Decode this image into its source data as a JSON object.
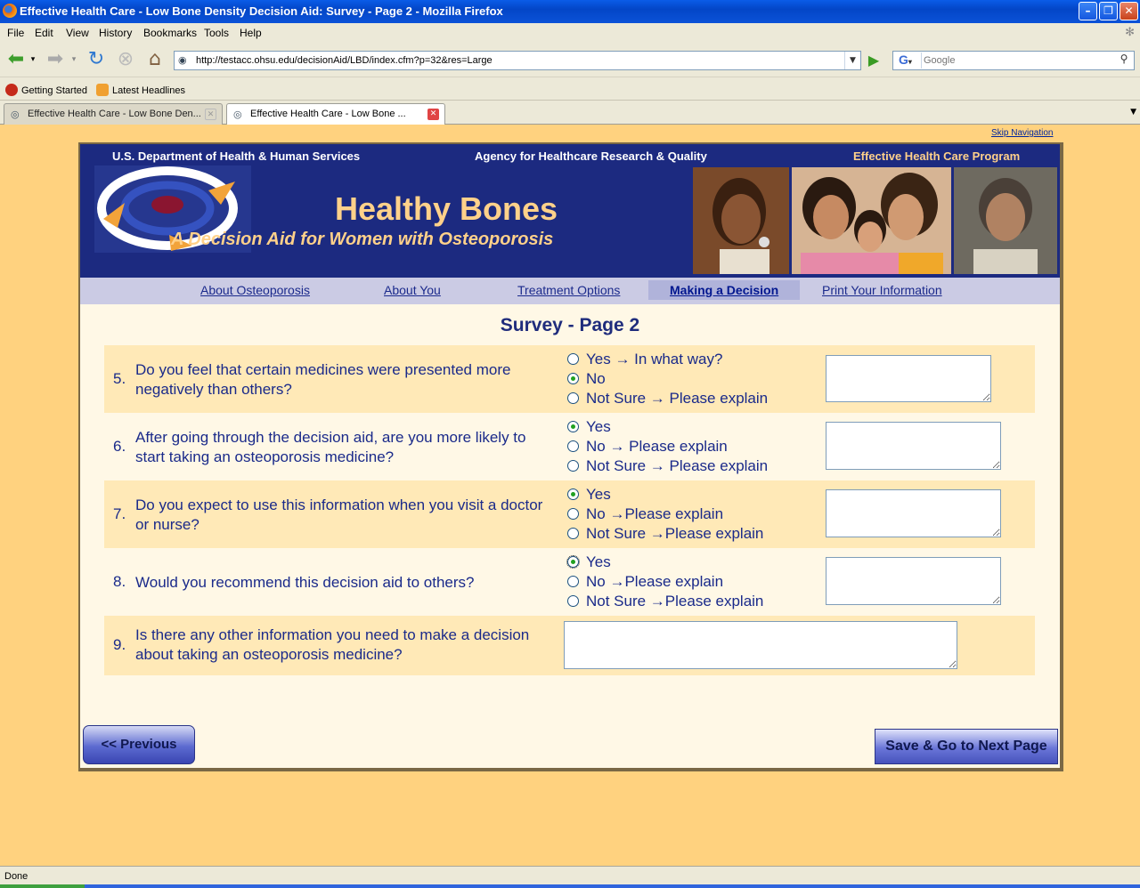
{
  "window": {
    "title": "Effective Health Care - Low Bone Density Decision Aid: Survey - Page 2 - Mozilla Firefox"
  },
  "menu": {
    "items": [
      "File",
      "Edit",
      "View",
      "History",
      "Bookmarks",
      "Tools",
      "Help"
    ]
  },
  "toolbar": {
    "url": "http://testacc.ohsu.edu/decisionAid/LBD/index.cfm?p=32&res=Large",
    "search_placeholder": "Google"
  },
  "bookmarks": {
    "items": [
      "Getting Started",
      "Latest Headlines"
    ]
  },
  "tabs": [
    "Effective Health Care - Low Bone Den...",
    "Effective Health Care - Low Bone ..."
  ],
  "page": {
    "skip_nav": "Skip Navigation",
    "header": {
      "left": "U.S. Department of Health & Human Services",
      "center": "Agency for Healthcare Research & Quality",
      "right": "Effective Health Care Program"
    },
    "banner_title": "Healthy Bones",
    "banner_subtitle": "A Decision Aid for Women with Osteoporosis",
    "nav": [
      "About Osteoporosis",
      "About You",
      "Treatment Options",
      "Making a Decision",
      "Print Your Information"
    ],
    "survey_title": "Survey - Page 2",
    "questions": [
      {
        "num": "5.",
        "text": "Do you feel that certain medicines were presented more negatively than others?",
        "options": [
          "Yes → In what way?",
          "No",
          "Not Sure → Please explain"
        ],
        "selected": 1
      },
      {
        "num": "6.",
        "text": "After going through the decision aid, are you more likely to start taking an osteoporosis medicine?",
        "options": [
          "Yes",
          "No → Please explain",
          "Not Sure → Please explain"
        ],
        "selected": 0
      },
      {
        "num": "7.",
        "text": "Do you expect to use this information when you visit a doctor or nurse?",
        "options": [
          "Yes",
          "No →Please explain",
          "Not Sure →Please explain"
        ],
        "selected": 0
      },
      {
        "num": "8.",
        "text": "Would you recommend this decision aid to others?",
        "options": [
          "Yes",
          "No →Please explain",
          "Not Sure →Please explain"
        ],
        "selected": 0
      },
      {
        "num": "9.",
        "text": "Is there any other information you need to make a decision about taking an osteoporosis medicine?"
      }
    ],
    "prev_button": "<< Previous",
    "next_button": "Save & Go to Next Page"
  },
  "status": {
    "text": "Done"
  },
  "colors": {
    "banner": "#1c2a80",
    "accent_text": "#ffd18a",
    "page_bg": "#ffd27f",
    "row_alt": "#ffe9b7"
  }
}
